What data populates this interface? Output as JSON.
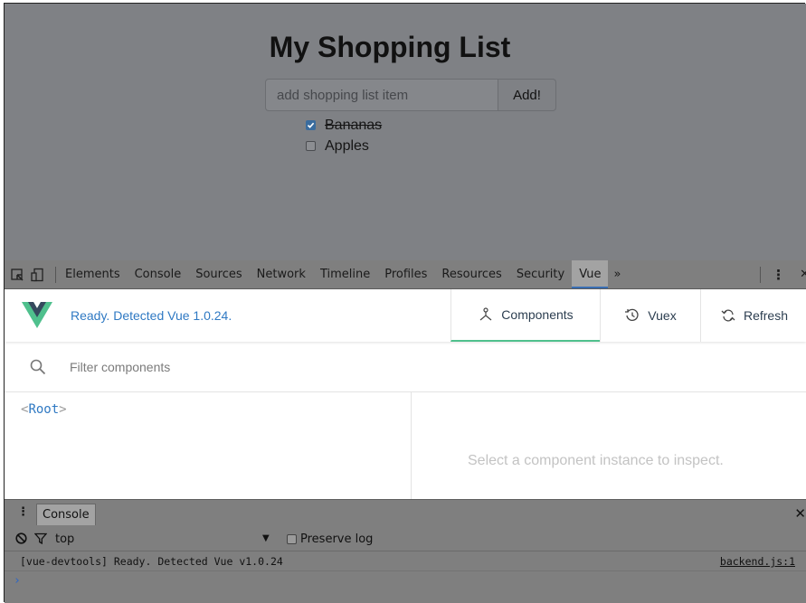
{
  "app": {
    "title": "My Shopping List",
    "input_placeholder": "add shopping list item",
    "add_button": "Add!",
    "items": [
      {
        "label": "Bananas",
        "checked": true
      },
      {
        "label": "Apples",
        "checked": false
      }
    ]
  },
  "devtools": {
    "tabs": [
      "Elements",
      "Console",
      "Sources",
      "Network",
      "Timeline",
      "Profiles",
      "Resources",
      "Security",
      "Vue"
    ],
    "active_tab": "Vue",
    "more_symbol": "»",
    "kebab_symbol": "⋮",
    "close_symbol": "✕"
  },
  "vue": {
    "status": "Ready. Detected Vue 1.0.24.",
    "tabs": {
      "components": "Components",
      "vuex": "Vuex",
      "refresh": "Refresh"
    },
    "filter_placeholder": "Filter components",
    "tree": {
      "open": "<",
      "name": "Root",
      "close": ">"
    },
    "inspect_hint": "Select a component instance to inspect."
  },
  "console": {
    "tab_label": "Console",
    "context": "top",
    "context_caret": "▼",
    "preserve_log": "Preserve log",
    "log": {
      "text": "[vue-devtools] Ready. Detected Vue v1.0.24",
      "source": "backend.js:1"
    },
    "prompt": "›"
  },
  "colors": {
    "vue_green": "#4fc08d",
    "vue_dark": "#35495e",
    "link_blue": "#2f79c3"
  }
}
